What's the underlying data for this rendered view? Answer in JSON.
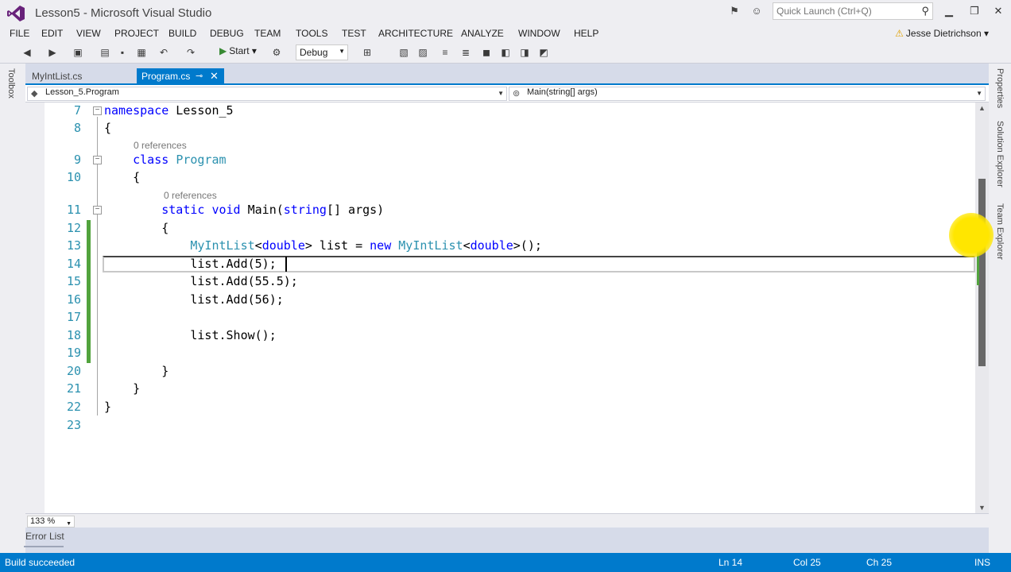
{
  "window": {
    "title": "Lesson5 - Microsoft Visual Studio",
    "quick_launch_placeholder": "Quick Launch (Ctrl+Q)",
    "user": "Jesse Dietrichson"
  },
  "menu": [
    "FILE",
    "EDIT",
    "VIEW",
    "PROJECT",
    "BUILD",
    "DEBUG",
    "TEAM",
    "TOOLS",
    "TEST",
    "ARCHITECTURE",
    "ANALYZE",
    "WINDOW",
    "HELP"
  ],
  "toolbar": {
    "start_label": "Start",
    "configuration": "Debug"
  },
  "left_panel": {
    "toolbox_label": "Toolbox"
  },
  "right_panel": {
    "properties_label": "Properties",
    "solution_explorer_label": "Solution Explorer",
    "team_explorer_label": "Team Explorer"
  },
  "tabs": {
    "inactive": "MyIntList.cs",
    "active": "Program.cs"
  },
  "navigation": {
    "type_dropdown": "Lesson_5.Program",
    "member_dropdown": "Main(string[] args)"
  },
  "editor": {
    "lines": [
      {
        "no": "7",
        "parts": [
          {
            "t": "namespace",
            "c": "kw"
          },
          {
            "t": " Lesson_5",
            "c": ""
          }
        ]
      },
      {
        "no": "8",
        "parts": [
          {
            "t": "{",
            "c": ""
          }
        ]
      },
      {
        "no": "9",
        "parts": [
          {
            "t": "    ",
            "c": ""
          },
          {
            "t": "class",
            "c": "kw"
          },
          {
            "t": " ",
            "c": ""
          },
          {
            "t": "Program",
            "c": "ty"
          }
        ]
      },
      {
        "no": "10",
        "parts": [
          {
            "t": "    {",
            "c": ""
          }
        ]
      },
      {
        "no": "11",
        "parts": [
          {
            "t": "        ",
            "c": ""
          },
          {
            "t": "static",
            "c": "kw"
          },
          {
            "t": " ",
            "c": ""
          },
          {
            "t": "void",
            "c": "kw"
          },
          {
            "t": " Main(",
            "c": ""
          },
          {
            "t": "string",
            "c": "kw"
          },
          {
            "t": "[] args)",
            "c": ""
          }
        ]
      },
      {
        "no": "12",
        "parts": [
          {
            "t": "        {",
            "c": ""
          }
        ]
      },
      {
        "no": "13",
        "parts": [
          {
            "t": "            ",
            "c": ""
          },
          {
            "t": "MyIntList",
            "c": "ty"
          },
          {
            "t": "<",
            "c": ""
          },
          {
            "t": "double",
            "c": "kw"
          },
          {
            "t": "> list = ",
            "c": ""
          },
          {
            "t": "new",
            "c": "kw"
          },
          {
            "t": " ",
            "c": ""
          },
          {
            "t": "MyIntList",
            "c": "ty"
          },
          {
            "t": "<",
            "c": ""
          },
          {
            "t": "double",
            "c": "kw"
          },
          {
            "t": ">();",
            "c": ""
          }
        ]
      },
      {
        "no": "14",
        "parts": [
          {
            "t": "            list.Add(5);",
            "c": ""
          }
        ]
      },
      {
        "no": "15",
        "parts": [
          {
            "t": "            list.Add(55.5);",
            "c": ""
          }
        ]
      },
      {
        "no": "16",
        "parts": [
          {
            "t": "            list.Add(56);",
            "c": ""
          }
        ]
      },
      {
        "no": "17",
        "parts": [
          {
            "t": "",
            "c": ""
          }
        ]
      },
      {
        "no": "18",
        "parts": [
          {
            "t": "            list.Show();",
            "c": ""
          }
        ]
      },
      {
        "no": "19",
        "parts": [
          {
            "t": "",
            "c": ""
          }
        ]
      },
      {
        "no": "20",
        "parts": [
          {
            "t": "        }",
            "c": ""
          }
        ]
      },
      {
        "no": "21",
        "parts": [
          {
            "t": "    }",
            "c": ""
          }
        ]
      },
      {
        "no": "22",
        "parts": [
          {
            "t": "}",
            "c": ""
          }
        ]
      },
      {
        "no": "23",
        "parts": [
          {
            "t": "",
            "c": ""
          }
        ]
      }
    ],
    "lens_class": "0 references",
    "lens_method": "0 references",
    "zoom": "133 %"
  },
  "bottom": {
    "error_list_label": "Error List"
  },
  "status": {
    "message": "Build succeeded",
    "ln": "Ln 14",
    "col": "Col 25",
    "ch": "Ch 25",
    "mode": "INS"
  },
  "colors": {
    "accent": "#007acc",
    "keyword": "#0000ff",
    "type": "#2b91af",
    "change_marker": "#52a33d"
  }
}
